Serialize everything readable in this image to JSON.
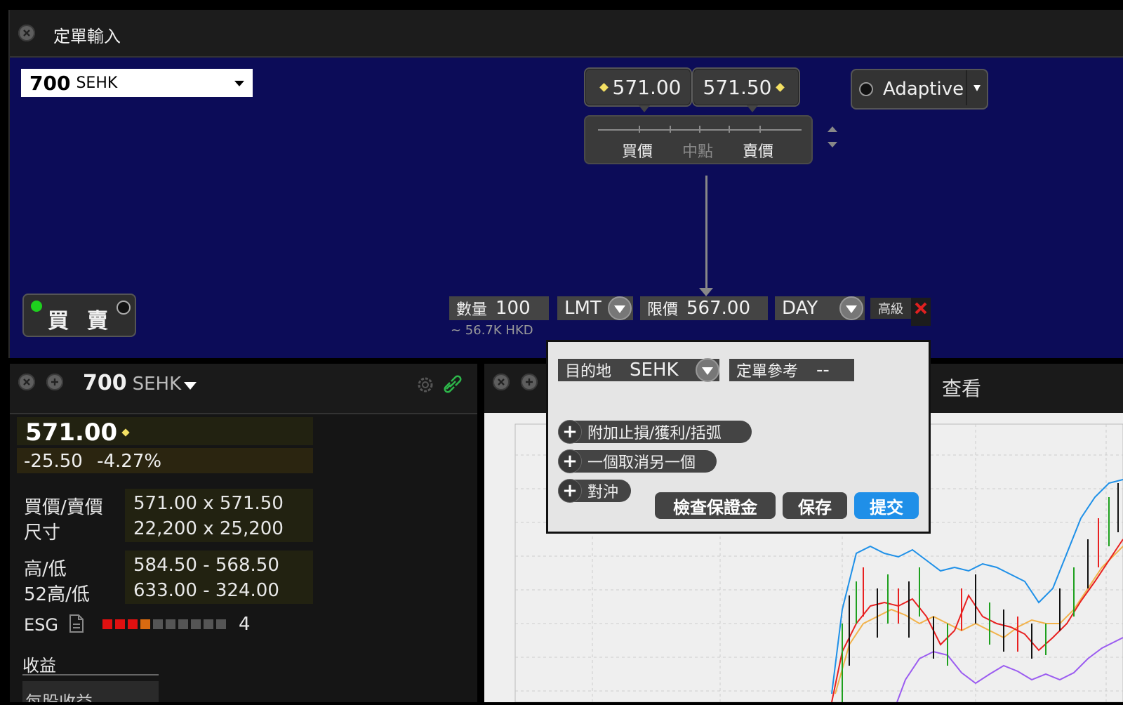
{
  "order_window": {
    "title": "定單輸入",
    "symbol": "700",
    "exchange": "SEHK",
    "bid_button": "571.00",
    "ask_button": "571.50",
    "slider_labels": {
      "bid": "買價",
      "mid": "中點",
      "ask": "賣價"
    },
    "algo": "Adaptive",
    "side": {
      "buy": "買",
      "sell": "賣"
    },
    "quantity_label": "數量",
    "quantity": "100",
    "notional": "~ 56.7K HKD",
    "order_type": "LMT",
    "limit_label": "限價",
    "limit_price": "567.00",
    "tif": "DAY",
    "advanced": "高級"
  },
  "popup": {
    "destination_label": "目的地",
    "destination": "SEHK",
    "order_ref_label": "定單參考",
    "order_ref": "--",
    "attach_bracket": "附加止損/獲利/括弧",
    "oco": "一個取消另一個",
    "hedge": "對沖",
    "check_margin": "檢查保證金",
    "save": "保存",
    "submit": "提交"
  },
  "quote_panel": {
    "symbol": "700",
    "exchange": "SEHK",
    "last": "571.00",
    "change": "-25.50",
    "change_pct": "-4.27%",
    "bid_ask_label": "買價/賣價",
    "bid_ask": "571.00 x 571.50",
    "size_label": "尺寸",
    "size": "22,200 x 25,200",
    "high_low_label": "高/低",
    "high_low": "584.50 - 568.50",
    "high_low_52_label": "52高/低",
    "high_low_52": "633.00 - 324.00",
    "esg_label": "ESG",
    "esg_score": "4",
    "earnings_label": "收益",
    "eps_label": "每股收益"
  },
  "chart_panel": {
    "view_label": "查看"
  },
  "colors": {
    "order_bg": "#0c0c58",
    "submit_blue": "#1f8fe8",
    "buy_green": "#1ed01e",
    "close_red": "#e02020",
    "diamond_yellow": "#f4e063"
  }
}
